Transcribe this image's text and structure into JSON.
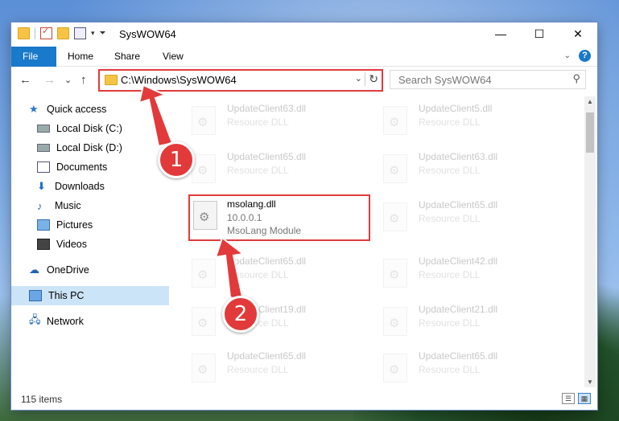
{
  "window": {
    "title": "SysWOW64",
    "controls": {
      "minimize": "—",
      "maximize": "☐",
      "close": "✕"
    }
  },
  "ribbon": {
    "tabs": [
      {
        "label": "File"
      },
      {
        "label": "Home"
      },
      {
        "label": "Share"
      },
      {
        "label": "View"
      }
    ],
    "help": "?"
  },
  "nav": {
    "back": "←",
    "forward": "→",
    "recent": "⌄",
    "up": "↑",
    "address_path": "C:\\Windows\\SysWOW64",
    "search_placeholder": "Search SysWOW64"
  },
  "sidebar": {
    "items": [
      {
        "label": "Quick access"
      },
      {
        "label": "Local Disk (C:)"
      },
      {
        "label": "Local Disk (D:)"
      },
      {
        "label": "Documents"
      },
      {
        "label": "Downloads"
      },
      {
        "label": "Music"
      },
      {
        "label": "Pictures"
      },
      {
        "label": "Videos"
      },
      {
        "label": "OneDrive"
      },
      {
        "label": "This PC"
      },
      {
        "label": "Network"
      }
    ]
  },
  "files": {
    "left": [
      {
        "name": "UpdateClient63.dll",
        "type": "Resource DLL"
      },
      {
        "name": "UpdateClient65.dll",
        "type": "Resource DLL"
      },
      {
        "name": "msolang.dll",
        "version": "10.0.0.1",
        "type": "MsoLang Module"
      },
      {
        "name": "UpdateClient65.dll",
        "type": "Resource DLL"
      },
      {
        "name": "UpdateClient19.dll",
        "type": "Resource DLL"
      },
      {
        "name": "UpdateClient65.dll",
        "type": "Resource DLL"
      }
    ],
    "right": [
      {
        "name": "UpdateClient5.dll",
        "type": "Resource DLL"
      },
      {
        "name": "UpdateClient63.dll",
        "type": "Resource DLL"
      },
      {
        "name": "UpdateClient65.dll",
        "type": "Resource DLL"
      },
      {
        "name": "UpdateClient42.dll",
        "type": "Resource DLL"
      },
      {
        "name": "UpdateClient21.dll",
        "type": "Resource DLL"
      },
      {
        "name": "UpdateClient65.dll",
        "type": "Resource DLL"
      }
    ]
  },
  "status": {
    "count": "115 items"
  },
  "annotations": {
    "step1": "1",
    "step2": "2",
    "color": "#e23a3a"
  }
}
